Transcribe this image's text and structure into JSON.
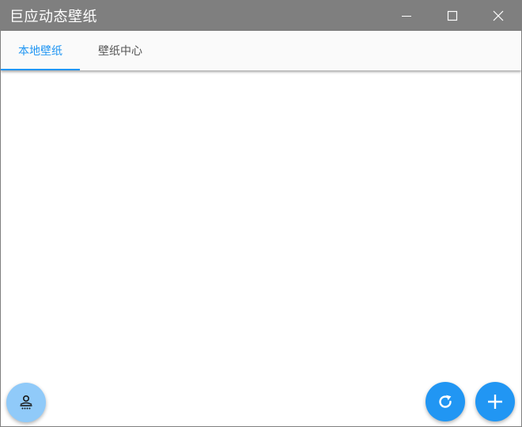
{
  "window": {
    "title": "巨应动态壁纸",
    "controls": {
      "minimize_icon": "minimize-icon",
      "maximize_icon": "maximize-icon",
      "close_icon": "close-icon"
    }
  },
  "tabs": [
    {
      "label": "本地壁纸",
      "active": true
    },
    {
      "label": "壁纸中心",
      "active": false
    }
  ],
  "fabs": {
    "left_icon": "wallpaper-person-icon",
    "refresh_icon": "refresh-icon",
    "add_icon": "plus-icon"
  },
  "colors": {
    "titlebar": "#7f7f7f",
    "accent": "#2196f3",
    "accent_light": "#90caf9",
    "tab_text": "#555555"
  }
}
